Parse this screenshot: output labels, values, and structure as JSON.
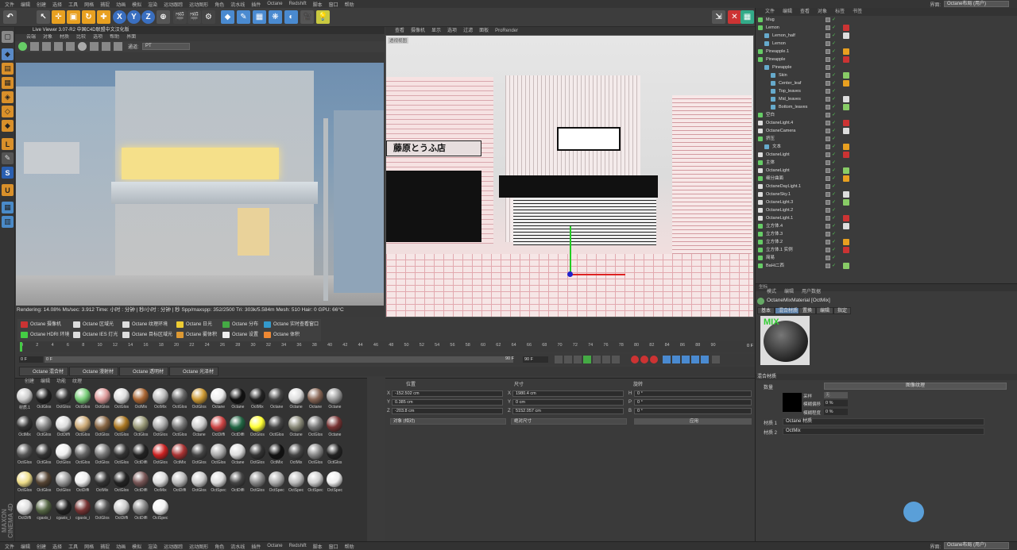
{
  "menubar": {
    "items": [
      "文件",
      "编辑",
      "创建",
      "选择",
      "工具",
      "网格",
      "捕捉",
      "动画",
      "模拟",
      "渲染",
      "运动跟踪",
      "运动图形",
      "角色",
      "流水线",
      "插件",
      "Octane",
      "Redshift",
      "脚本",
      "窗口",
      "帮助"
    ],
    "layout_label": "界面:",
    "layout_value": "Octane布局 (用户)"
  },
  "toolbar": {
    "axis_x": "X",
    "axis_y": "Y",
    "axis_z": "Z"
  },
  "live_viewer": {
    "title": "Live Viewer 3.07-R2 中国C4D联盟中文汉化版",
    "menu": [
      "云端",
      "对象",
      "材质",
      "比较",
      "选项",
      "帮助",
      "界面"
    ],
    "mode_label": "通道:",
    "mode_value": "PT",
    "overlay": "Rendering: 14.08%  Ms/sec: 3.912  Time: 小时 : 分钟 | 秒/小时 : 分钟 | 秒  Spp/maxspp: 352/2500  Tri: 303k/5.584m  Mesh: 510  Hair: 0  GPU: 66°C"
  },
  "viewport": {
    "menu": [
      "查看",
      "摄像机",
      "显示",
      "选项",
      "过滤",
      "面板",
      "ProRender"
    ],
    "label": "透视视图",
    "sign_text": "藤原とうふ店"
  },
  "object_manager": {
    "menu": [
      "文件",
      "编辑",
      "查看",
      "对象",
      "标签",
      "书签"
    ],
    "rows": [
      {
        "name": "Mug",
        "indent": 0
      },
      {
        "name": "Lemon",
        "indent": 0
      },
      {
        "name": "Lemon_half",
        "indent": 1
      },
      {
        "name": "Lemon",
        "indent": 1
      },
      {
        "name": "Pineapple.1",
        "indent": 0
      },
      {
        "name": "Pineapple",
        "indent": 0
      },
      {
        "name": "Pineapple",
        "indent": 1
      },
      {
        "name": "Skin",
        "indent": 2
      },
      {
        "name": "Center_leaf",
        "indent": 2
      },
      {
        "name": "Top_leaves",
        "indent": 2
      },
      {
        "name": "Mid_leaves",
        "indent": 2
      },
      {
        "name": "Bottom_leaves",
        "indent": 2
      },
      {
        "name": "空白",
        "indent": 0
      },
      {
        "name": "OctaneLight.4",
        "indent": 0
      },
      {
        "name": "OctaneCamera",
        "indent": 0
      },
      {
        "name": "挤压",
        "indent": 0
      },
      {
        "name": "文本",
        "indent": 1
      },
      {
        "name": "OctaneLight",
        "indent": 0
      },
      {
        "name": "主体",
        "indent": 0
      },
      {
        "name": "OctaneLight",
        "indent": 0
      },
      {
        "name": "细分曲面",
        "indent": 0
      },
      {
        "name": "OctaneDayLight.1",
        "indent": 0
      },
      {
        "name": "OctaneSky.1",
        "indent": 0
      },
      {
        "name": "OctaneLight.3",
        "indent": 0
      },
      {
        "name": "OctaneLight.2",
        "indent": 0
      },
      {
        "name": "OctaneLight.1",
        "indent": 0
      },
      {
        "name": "立方体.4",
        "indent": 0
      },
      {
        "name": "立方体.3",
        "indent": 0
      },
      {
        "name": "立方体.2",
        "indent": 0
      },
      {
        "name": "立方体.1 实例",
        "indent": 0
      },
      {
        "name": "简易",
        "indent": 0
      },
      {
        "name": "BaHi二西",
        "indent": 0
      }
    ]
  },
  "attributes": {
    "menu": [
      "模式",
      "编辑",
      "用户数据"
    ],
    "material_title": "OctaneMixMaterial [OctMix]",
    "tabs": [
      "基本",
      "混合材质",
      "置换",
      "编辑",
      "指定"
    ],
    "mix_label": "MIX",
    "section": "混合材质",
    "amount_label": "数量",
    "image_tex": "图像纹理",
    "sample_label": "采样",
    "sample_value": "无",
    "blur_offset_label": "模糊偏移",
    "blur_offset_value": "0 %",
    "blur_scale_label": "模糊程度",
    "blur_scale_value": "0 %",
    "mat1_label": "材质 1",
    "mat1_value": "Octane 材质",
    "mat2_label": "材质 2",
    "mat2_value": "OctMix",
    "header_label": "坐标"
  },
  "octane_buttons": [
    {
      "label": "Octane 摄像机",
      "color": "#c33"
    },
    {
      "label": "Octane 区域光",
      "color": "#ddd"
    },
    {
      "label": "Octane 纹理环境",
      "color": "#ddd"
    },
    {
      "label": "Octane 日光",
      "color": "#ec3"
    },
    {
      "label": "Octane 分布",
      "color": "#4a4"
    },
    {
      "label": "Octane 实时查看窗口",
      "color": "#39c"
    },
    {
      "label": "Octane HDRI 环境",
      "color": "#4c4"
    },
    {
      "label": "Octane IES 灯光",
      "color": "#ddd"
    },
    {
      "label": "Octane 目标区域光",
      "color": "#ddd"
    },
    {
      "label": "Octane 雾体积",
      "color": "#d93"
    },
    {
      "label": "Octane 设置",
      "color": "#eee"
    },
    {
      "label": "Octane 体积",
      "color": "#e83"
    }
  ],
  "timeline": {
    "ticks": [
      "0",
      "2",
      "4",
      "6",
      "8",
      "10",
      "12",
      "14",
      "16",
      "18",
      "20",
      "22",
      "24",
      "26",
      "28",
      "30",
      "32",
      "34",
      "36",
      "38",
      "40",
      "42",
      "44",
      "46",
      "48",
      "50",
      "52",
      "54",
      "56",
      "58",
      "60",
      "62",
      "64",
      "66",
      "68",
      "70",
      "72",
      "74",
      "76",
      "78",
      "80",
      "82",
      "84",
      "86",
      "88",
      "90"
    ],
    "end_label": "0 F",
    "frame_start": "0 F",
    "frame_cur": "0 F",
    "frame_end": "90 F",
    "frame_end2": "90 F"
  },
  "material_tabs": [
    "Octane 混合材质",
    "Octane 漫射材质",
    "Octane 透明材质",
    "Octane 光泽材质"
  ],
  "material_manager": {
    "menu": [
      "创建",
      "编辑",
      "功能",
      "纹理"
    ]
  },
  "materials": [
    {
      "label": "材质.1",
      "c": "#ccc"
    },
    {
      "label": "OctGlos",
      "c": "#222"
    },
    {
      "label": "OctGlos",
      "c": "#333"
    },
    {
      "label": "OctGlos",
      "c": "#7c7"
    },
    {
      "label": "OctGlos",
      "c": "#d99"
    },
    {
      "label": "OctGlos",
      "c": "#ddd"
    },
    {
      "label": "OctMix",
      "c": "#a63"
    },
    {
      "label": "OctMix",
      "c": "#bbb"
    },
    {
      "label": "OctGlos",
      "c": "#666"
    },
    {
      "label": "OctGlos",
      "c": "#c93"
    },
    {
      "label": "Octane",
      "c": "#eee"
    },
    {
      "label": "Octane",
      "c": "#111"
    },
    {
      "label": "OctMix",
      "c": "#222"
    },
    {
      "label": "Octane",
      "c": "#444"
    },
    {
      "label": "Octane",
      "c": "#ddd"
    },
    {
      "label": "Octane",
      "c": "#865"
    },
    {
      "label": "Octane",
      "c": "#999"
    },
    {
      "label": "OctMix",
      "c": "#333"
    },
    {
      "label": "OctGlos",
      "c": "#888"
    },
    {
      "label": "OctDiffi",
      "c": "#ddd"
    },
    {
      "label": "OctGlos",
      "c": "#ca7"
    },
    {
      "label": "OctGlos",
      "c": "#864"
    },
    {
      "label": "OctGlos",
      "c": "#a72"
    },
    {
      "label": "OctGlos",
      "c": "#997"
    },
    {
      "label": "OctGlos",
      "c": "#aaa"
    },
    {
      "label": "OctGlos",
      "c": "#777"
    },
    {
      "label": "Octane",
      "c": "#ccc"
    },
    {
      "label": "OctDiffi",
      "c": "#c44"
    },
    {
      "label": "OctDiffi",
      "c": "#264"
    },
    {
      "label": "OctGlos",
      "c": "#ff3"
    },
    {
      "label": "OctGlos",
      "c": "#444"
    },
    {
      "label": "Octane",
      "c": "#887"
    },
    {
      "label": "OctGlos",
      "c": "#777"
    },
    {
      "label": "Octane",
      "c": "#733"
    },
    {
      "label": "OctGlos",
      "c": "#555"
    },
    {
      "label": "OctGlos",
      "c": "#333"
    },
    {
      "label": "OctGlos",
      "c": "#eee"
    },
    {
      "label": "OctGlos",
      "c": "#666"
    },
    {
      "label": "OctGlos",
      "c": "#777"
    },
    {
      "label": "OctGlos",
      "c": "#333"
    },
    {
      "label": "OctDiffi",
      "c": "#222"
    },
    {
      "label": "OctGlos",
      "c": "#c22"
    },
    {
      "label": "OctMix",
      "c": "#a33"
    },
    {
      "label": "OctGlos",
      "c": "#444"
    },
    {
      "label": "OctGlos",
      "c": "#aaa"
    },
    {
      "label": "Octane",
      "c": "#ddd"
    },
    {
      "label": "OctGlos",
      "c": "#333"
    },
    {
      "label": "OctMix",
      "c": "#111"
    },
    {
      "label": "OctMix",
      "c": "#444"
    },
    {
      "label": "OctGlos",
      "c": "#888"
    },
    {
      "label": "OctGlos",
      "c": "#222"
    },
    {
      "label": "OctGlos",
      "c": "#ed8"
    },
    {
      "label": "OctGlos",
      "c": "#543"
    },
    {
      "label": "OctGlos",
      "c": "#999"
    },
    {
      "label": "OctDiffi",
      "c": "#eee"
    },
    {
      "label": "OctMix",
      "c": "#333"
    },
    {
      "label": "OctGlos",
      "c": "#222"
    },
    {
      "label": "OctDiffi",
      "c": "#755"
    },
    {
      "label": "OctMix",
      "c": "#ddd"
    },
    {
      "label": "OctDiffi",
      "c": "#bbb"
    },
    {
      "label": "OctGlos",
      "c": "#ccc"
    },
    {
      "label": "OctSpec",
      "c": "#ddd"
    },
    {
      "label": "OctDiffi",
      "c": "#444"
    },
    {
      "label": "OctGlos",
      "c": "#888"
    },
    {
      "label": "OctSpec",
      "c": "#aaa"
    },
    {
      "label": "OctSpec",
      "c": "#bbb"
    },
    {
      "label": "OctSpec",
      "c": "#ccc"
    },
    {
      "label": "OctSpec",
      "c": "#eee"
    },
    {
      "label": "OctDiffi",
      "c": "#ddd"
    },
    {
      "label": "cgaxis_i",
      "c": "#564"
    },
    {
      "label": "cgaxis_i",
      "c": "#222"
    },
    {
      "label": "cgaxis_i",
      "c": "#733"
    },
    {
      "label": "OctGlos",
      "c": "#555"
    },
    {
      "label": "OctDiffi",
      "c": "#ccc"
    },
    {
      "label": "OctDiffi",
      "c": "#888"
    },
    {
      "label": "OctSpec",
      "c": "#f4f4f4"
    }
  ],
  "coords": {
    "pos_hdr": "位置",
    "size_hdr": "尺寸",
    "rot_hdr": "旋转",
    "x_lbl": "X",
    "y_lbl": "Y",
    "z_lbl": "Z",
    "px": "-152.502 cm",
    "py": "0.385 cm",
    "pz": "-203.8 cm",
    "sx": "1980.4 cm",
    "sy": "0 cm",
    "sz": "5152.057 cm",
    "rh": "0 °",
    "rp": "0 °",
    "rb": "0 °",
    "rh_lbl": "H",
    "rp_lbl": "P",
    "rb_lbl": "B",
    "mode1": "对象 (相对)",
    "mode2": "绝对尺寸",
    "apply": "应用"
  },
  "footer": {
    "brand": "MAXON CINEMA 4D"
  }
}
